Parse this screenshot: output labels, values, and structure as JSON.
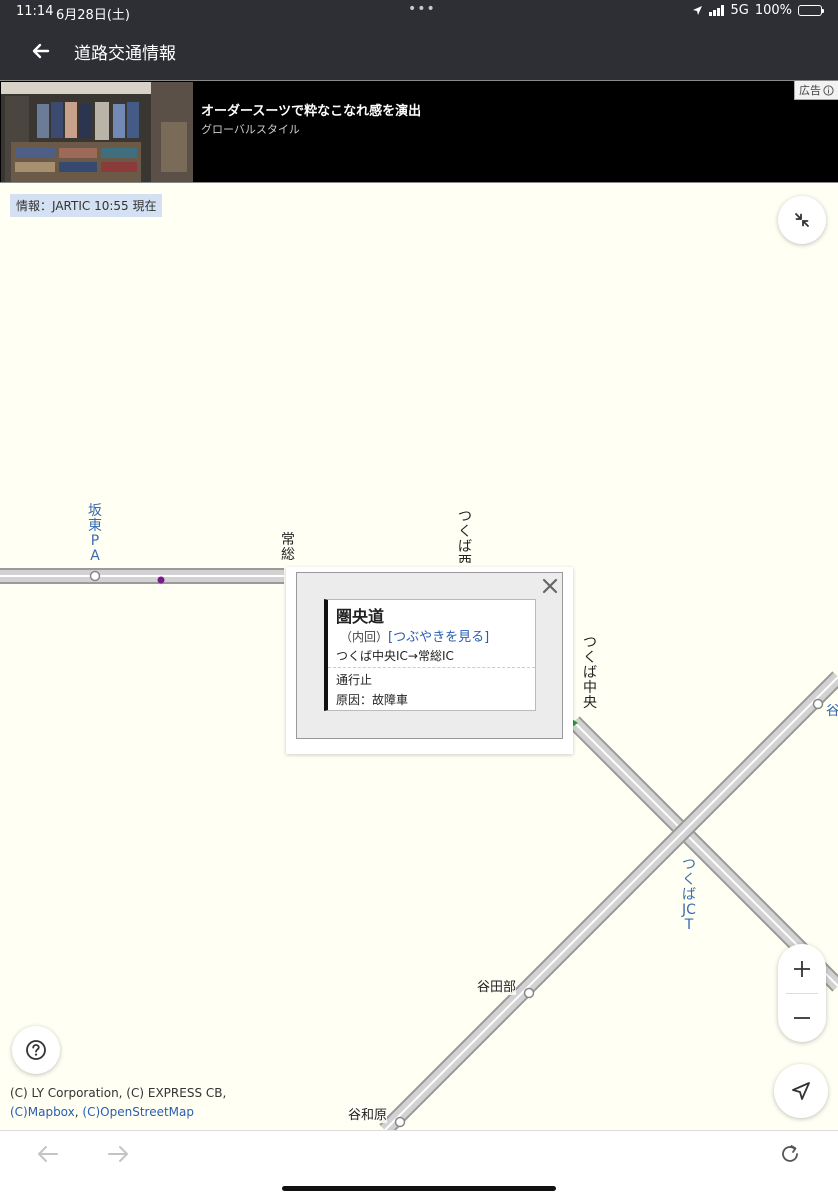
{
  "status_bar": {
    "time": "11:14",
    "date": "6月28日(土)",
    "network": "5G",
    "battery": "100%",
    "icons": [
      "location-arrow-icon",
      "signal-bars-icon",
      "battery-icon"
    ]
  },
  "header": {
    "back_icon": "back-arrow-icon",
    "title": "道路交通情報"
  },
  "ad": {
    "headline": "オーダースーツで粋なこなれ感を演出",
    "sponsor": "グローバルスタイル",
    "badge": "広告",
    "badge_icon": "info-icon"
  },
  "map": {
    "source": "情報：JARTIC 10:55 現在",
    "labels": {
      "bando_pa": "坂東PA",
      "joso": "常総",
      "tsukuba_nishi": "つくば西",
      "tsukuba_chuo": "つくば中央",
      "tsukuba_jct": "つくばJCT",
      "yatabe": "谷田部",
      "yawara": "谷和原",
      "edge": "谷"
    },
    "copyright_line1": "(C) LY Corporation, (C) EXPRESS CB,",
    "copyright_link1": "(C)Mapbox",
    "copyright_sep": ", ",
    "copyright_link2": "(C)OpenStreetMap",
    "buttons": {
      "collapse_icon": "collapse-arrows-icon",
      "help_icon": "help-circle-icon",
      "zoom_in_icon": "plus-icon",
      "zoom_out_icon": "minus-icon",
      "locate_icon": "navigation-arrow-icon"
    },
    "colors": {
      "road_fill": "#d2d2d2",
      "road_edge": "#9a9a9a",
      "label_blue": "#3a6bb0",
      "incident_marker": "#7a1a8a",
      "map_bg": "#fffff4"
    }
  },
  "popup": {
    "close_icon": "close-x-icon",
    "road_name": "圏央道",
    "direction": "（内回）",
    "tweet_link": "[つぶやきを見る]",
    "section": "つくば中央IC→常総IC",
    "status": "通行止",
    "cause": "原因：故障車"
  },
  "bottom_bar": {
    "back_icon": "browser-back-icon",
    "forward_icon": "browser-forward-icon",
    "reload_icon": "reload-icon"
  }
}
